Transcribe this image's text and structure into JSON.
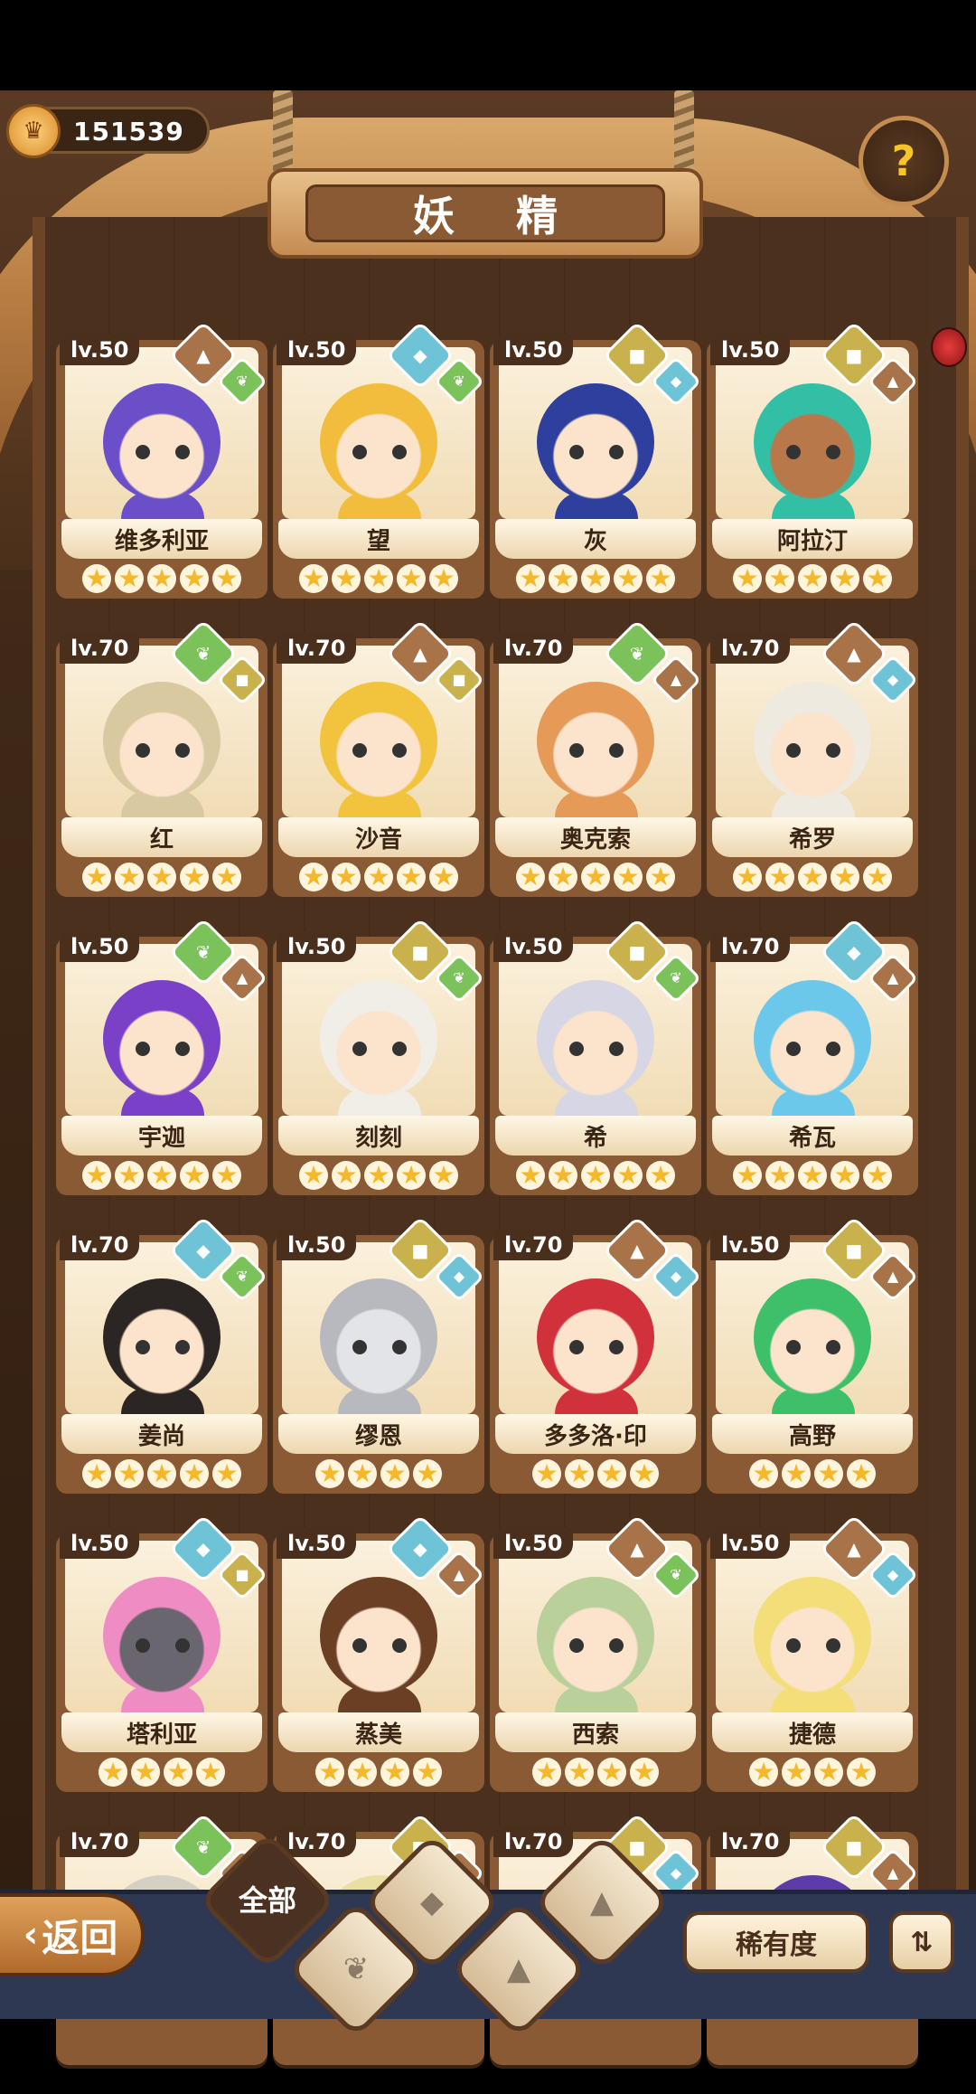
{
  "top": {
    "currency_amount": "151539",
    "title": "妖 精",
    "help_glyph": "?"
  },
  "colors": {
    "rock": "#a9734a",
    "water": "#6fc3d6",
    "plant": "#7bc25a",
    "earth": "#c9b24e"
  },
  "icons": {
    "rock": "▲",
    "water": "◆",
    "plant": "❦",
    "earth": "■"
  },
  "fairies": [
    {
      "level": "lv.50",
      "name": "维多利亚",
      "stars": 5,
      "el1": "rock",
      "el2": "plant",
      "hair": "#6a4fc9",
      "skin": "#fbe3cc"
    },
    {
      "level": "lv.50",
      "name": "望",
      "stars": 5,
      "el1": "water",
      "el2": "plant",
      "hair": "#f2bd3c",
      "skin": "#fbe3cc"
    },
    {
      "level": "lv.50",
      "name": "灰",
      "stars": 5,
      "el1": "earth",
      "el2": "water",
      "hair": "#2f3f9e",
      "skin": "#fbe3cc"
    },
    {
      "level": "lv.50",
      "name": "阿拉汀",
      "stars": 5,
      "el1": "earth",
      "el2": "rock",
      "hair": "#33bfa5",
      "skin": "#b8784a"
    },
    {
      "level": "lv.70",
      "name": "红",
      "stars": 5,
      "el1": "plant",
      "el2": "earth",
      "hair": "#d8c9a0",
      "skin": "#fbe3cc"
    },
    {
      "level": "lv.70",
      "name": "沙音",
      "stars": 5,
      "el1": "rock",
      "el2": "earth",
      "hair": "#f2c33c",
      "skin": "#fbe3cc"
    },
    {
      "level": "lv.70",
      "name": "奥克索",
      "stars": 5,
      "el1": "plant",
      "el2": "rock",
      "hair": "#e59a58",
      "skin": "#fbe3cc"
    },
    {
      "level": "lv.70",
      "name": "希罗",
      "stars": 5,
      "el1": "rock",
      "el2": "water",
      "hair": "#eeeae0",
      "skin": "#fbe3cc"
    },
    {
      "level": "lv.50",
      "name": "宇迦",
      "stars": 5,
      "el1": "plant",
      "el2": "rock",
      "hair": "#7b40c8",
      "skin": "#fbe3cc"
    },
    {
      "level": "lv.50",
      "name": "刻刻",
      "stars": 5,
      "el1": "earth",
      "el2": "plant",
      "hair": "#f1eee8",
      "skin": "#fbe3cc"
    },
    {
      "level": "lv.50",
      "name": "希",
      "stars": 5,
      "el1": "earth",
      "el2": "plant",
      "hair": "#d6d6e4",
      "skin": "#fbe3cc"
    },
    {
      "level": "lv.70",
      "name": "希瓦",
      "stars": 5,
      "el1": "water",
      "el2": "rock",
      "hair": "#6cc8ea",
      "skin": "#fbe3cc"
    },
    {
      "level": "lv.70",
      "name": "姜尚",
      "stars": 5,
      "el1": "water",
      "el2": "plant",
      "hair": "#2b2623",
      "skin": "#fbe3cc"
    },
    {
      "level": "lv.50",
      "name": "缪恩",
      "stars": 4,
      "el1": "earth",
      "el2": "water",
      "hair": "#b7b9bf",
      "skin": "#e3e4e8"
    },
    {
      "level": "lv.70",
      "name": "多多洛·印",
      "stars": 4,
      "el1": "rock",
      "el2": "water",
      "hair": "#d1313a",
      "skin": "#fbe3cc"
    },
    {
      "level": "lv.50",
      "name": "高野",
      "stars": 4,
      "el1": "earth",
      "el2": "rock",
      "hair": "#3ec06a",
      "skin": "#fbe3cc"
    },
    {
      "level": "lv.50",
      "name": "塔利亚",
      "stars": 4,
      "el1": "water",
      "el2": "earth",
      "hair": "#f08cc4",
      "skin": "#6a6670"
    },
    {
      "level": "lv.50",
      "name": "蒸美",
      "stars": 4,
      "el1": "water",
      "el2": "rock",
      "hair": "#6a3f24",
      "skin": "#fbe3cc"
    },
    {
      "level": "lv.50",
      "name": "西索",
      "stars": 4,
      "el1": "rock",
      "el2": "plant",
      "hair": "#b9d09a",
      "skin": "#fbe3cc"
    },
    {
      "level": "lv.50",
      "name": "捷德",
      "stars": 4,
      "el1": "rock",
      "el2": "water",
      "hair": "#f3de7a",
      "skin": "#fbe3cc"
    },
    {
      "level": "lv.70",
      "name": "",
      "stars": 0,
      "el1": "plant",
      "el2": "rock",
      "hair": "#d5d0c4",
      "skin": "#fbe3cc"
    },
    {
      "level": "lv.70",
      "name": "",
      "stars": 0,
      "el1": "earth",
      "el2": "rock",
      "hair": "#e8e0a0",
      "skin": "#fbe3cc"
    },
    {
      "level": "lv.70",
      "name": "",
      "stars": 0,
      "el1": "earth",
      "el2": "water",
      "hair": "#d6d6d6",
      "skin": "#fbe3cc"
    },
    {
      "level": "lv.70",
      "name": "",
      "stars": 0,
      "el1": "earth",
      "el2": "rock",
      "hair": "#5b3ca8",
      "skin": "#fbe3cc"
    }
  ],
  "bottom": {
    "back_label": "返回",
    "filter_all_label": "全部",
    "sort_label": "稀有度",
    "order_glyph": "⇅"
  }
}
